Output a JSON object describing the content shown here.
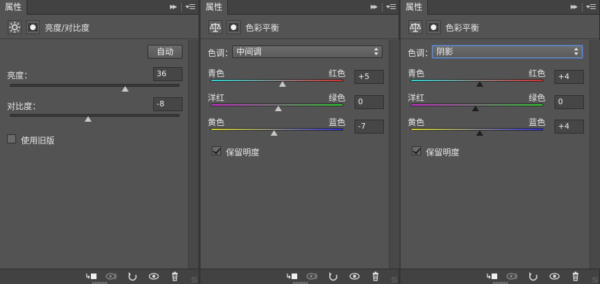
{
  "panels": [
    {
      "tab_label": "属性",
      "header_title": "亮度/对比度",
      "auto_label": "自动",
      "brightness": {
        "label": "亮度：",
        "value": "36",
        "level": 0.68
      },
      "contrast": {
        "label": "对比度：",
        "value": "-8",
        "level": 0.46
      },
      "legacy": {
        "label": "使用旧版",
        "checked": false
      }
    },
    {
      "tab_label": "属性",
      "header_title": "色彩平衡",
      "tone_label": "色调：",
      "tone_value": "中间调",
      "sliders": [
        {
          "left": "青色",
          "right": "红色",
          "value": "+5",
          "level": 0.54
        },
        {
          "left": "洋红",
          "right": "绿色",
          "value": "0",
          "level": 0.51
        },
        {
          "left": "黄色",
          "right": "蓝色",
          "value": "-7",
          "level": 0.48
        }
      ],
      "preserve": {
        "label": "保留明度",
        "checked": true
      }
    },
    {
      "tab_label": "属性",
      "header_title": "色彩平衡",
      "tone_label": "色调：",
      "tone_value": "阴影",
      "sliders": [
        {
          "left": "青色",
          "right": "红色",
          "value": "+4",
          "level": 0.52
        },
        {
          "left": "洋红",
          "right": "绿色",
          "value": "0",
          "level": 0.49
        },
        {
          "left": "黄色",
          "right": "蓝色",
          "value": "+4",
          "level": 0.52
        }
      ],
      "preserve": {
        "label": "保留明度",
        "checked": true
      }
    }
  ],
  "colors": {
    "panel_bg": "#535353",
    "cyan_red": [
      "#2fd6d6",
      "#d62f2f"
    ],
    "magenta_green": [
      "#d62fd6",
      "#2fd62f"
    ],
    "yellow_blue": [
      "#d6d62f",
      "#2f2fd6"
    ],
    "focus": "#6d8fc4"
  },
  "footer_icons": [
    "clip-to-layer-icon",
    "view-previous-icon",
    "reset-icon",
    "visibility-eye-icon",
    "trash-icon"
  ]
}
